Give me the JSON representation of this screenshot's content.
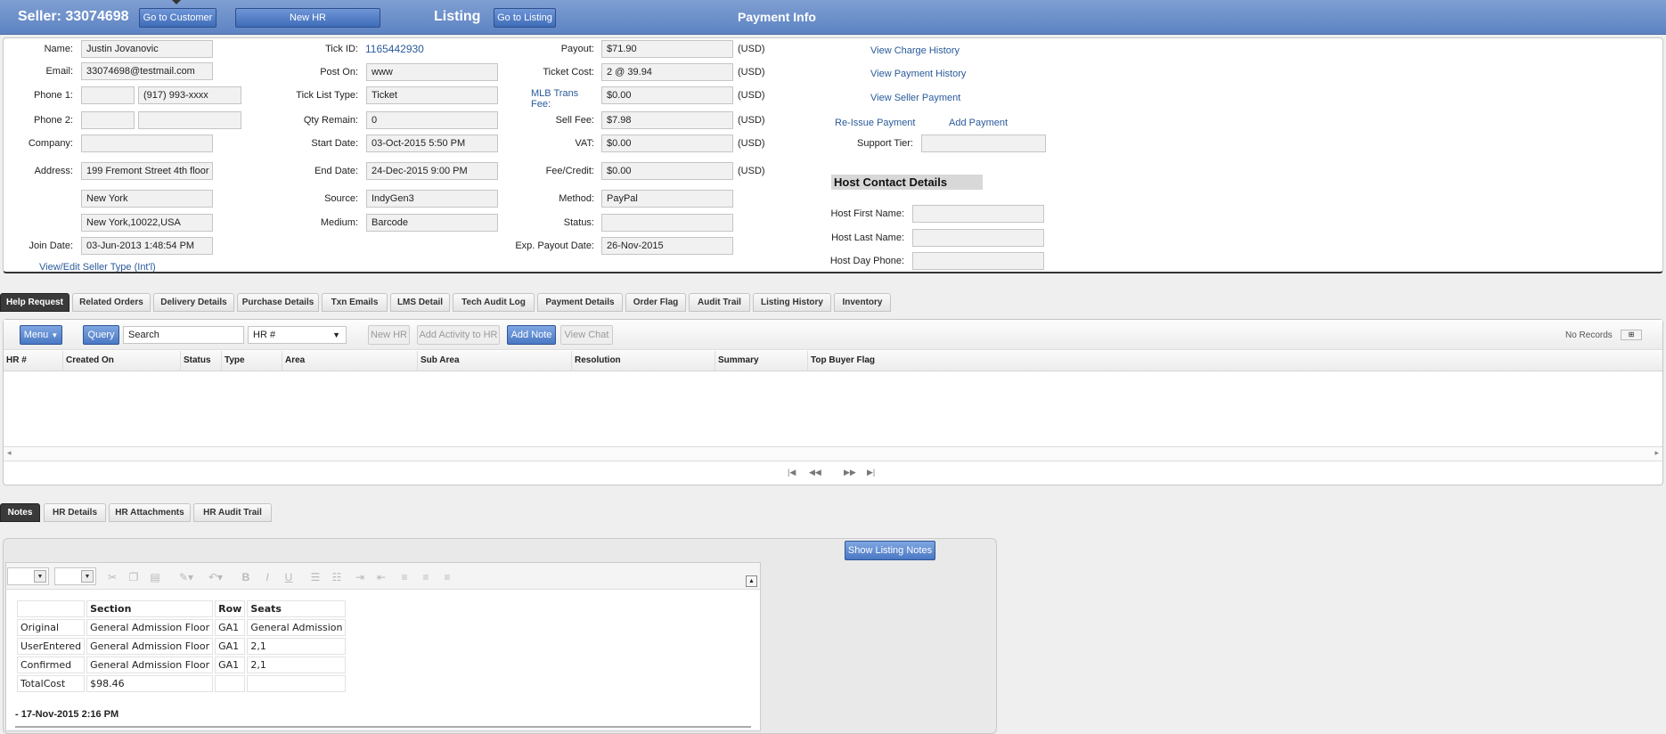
{
  "header": {
    "seller_title": "Seller: 33074698",
    "go_to_customer": "Go to Customer",
    "new_hr": "New HR",
    "listing_title": "Listing",
    "go_to_listing": "Go to Listing",
    "payment_info_title": "Payment Info"
  },
  "seller": {
    "name_label": "Name:",
    "name": "Justin Jovanovic",
    "email_label": "Email:",
    "email": "33074698@testmail.com",
    "phone1_label": "Phone 1:",
    "phone1_a": "",
    "phone1_b": "(917) 993-xxxx",
    "phone2_label": "Phone 2:",
    "phone2_a": "",
    "phone2_b": "",
    "company_label": "Company:",
    "company": "",
    "address_label": "Address:",
    "address1": "199 Fremont Street 4th floor",
    "address2": "New York",
    "address3": "New York,10022,USA",
    "join_label": "Join Date:",
    "join_date": "03-Jun-2013 1:48:54 PM",
    "seller_type_link": "View/Edit Seller Type (Int'l)"
  },
  "listing": {
    "tick_id_label": "Tick ID:",
    "tick_id": "1165442930",
    "post_on_label": "Post On:",
    "post_on": "www",
    "tick_list_type_label": "Tick List Type:",
    "tick_list_type": "Ticket",
    "qty_remain_label": "Qty Remain:",
    "qty_remain": "0",
    "start_date_label": "Start Date:",
    "start_date": "03-Oct-2015 5:50 PM",
    "end_date_label": "End Date:",
    "end_date": "24-Dec-2015 9:00 PM",
    "source_label": "Source:",
    "source": "IndyGen3",
    "medium_label": "Medium:",
    "medium": "Barcode"
  },
  "payment": {
    "payout_label": "Payout:",
    "payout": "$71.90",
    "ticket_cost_label": "Ticket Cost:",
    "ticket_cost": "2 @ 39.94",
    "mlb_label_1": "MLB Trans",
    "mlb_label_2": "Fee:",
    "mlb_fee": "$0.00",
    "sell_fee_label": "Sell Fee:",
    "sell_fee": "$7.98",
    "vat_label": "VAT:",
    "vat": "$0.00",
    "fee_credit_label": "Fee/Credit:",
    "fee_credit": "$0.00",
    "method_label": "Method:",
    "method": "PayPal",
    "status_label": "Status:",
    "status": "",
    "exp_payout_label": "Exp. Payout Date:",
    "exp_payout_date": "26-Nov-2015",
    "currency": "(USD)"
  },
  "links": {
    "view_charge_history": "View Charge History",
    "view_payment_history": "View Payment History",
    "view_seller_payment": "View Seller Payment",
    "reissue_payment": "Re-Issue Payment",
    "add_payment": "Add Payment",
    "support_tier_label": "Support Tier:",
    "support_tier": ""
  },
  "host": {
    "section_title": "Host Contact Details",
    "first_name_label": "Host First Name:",
    "first_name": "",
    "last_name_label": "Host Last Name:",
    "last_name": "",
    "day_phone_label": "Host Day Phone:",
    "day_phone": ""
  },
  "tabs": [
    "Help Request",
    "Related Orders",
    "Delivery Details",
    "Purchase Details",
    "Txn Emails",
    "LMS Detail",
    "Tech Audit Log",
    "Payment Details",
    "Order Flag",
    "Audit Trail",
    "Listing History",
    "Inventory"
  ],
  "hr_toolbar": {
    "menu": "Menu",
    "query": "Query",
    "search_value": "Search",
    "select_value": "HR #",
    "new_hr": "New HR",
    "add_activity": "Add Activity to HR",
    "add_note": "Add Note",
    "view_chat": "View Chat",
    "no_records": "No Records"
  },
  "hr_grid_columns": [
    "HR #",
    "Created On",
    "Status",
    "Type",
    "Area",
    "Sub Area",
    "Resolution",
    "Summary",
    "Top Buyer Flag"
  ],
  "note_tabs": [
    "Notes",
    "HR Details",
    "HR Attachments",
    "HR Audit Trail"
  ],
  "show_listing_notes": "Show Listing Notes",
  "seats_table": {
    "headers": [
      "",
      "Section",
      "Row",
      "Seats"
    ],
    "rows": [
      [
        "Original",
        "General Admission Floor",
        "GA1",
        "General Admission"
      ],
      [
        "UserEntered",
        "General Admission Floor",
        "GA1",
        "2,1"
      ],
      [
        "Confirmed",
        "General Admission Floor",
        "GA1",
        "2,1"
      ],
      [
        "TotalCost",
        "$98.46",
        "",
        ""
      ]
    ]
  },
  "note_entry_date": "- 17-Nov-2015 2:16 PM"
}
